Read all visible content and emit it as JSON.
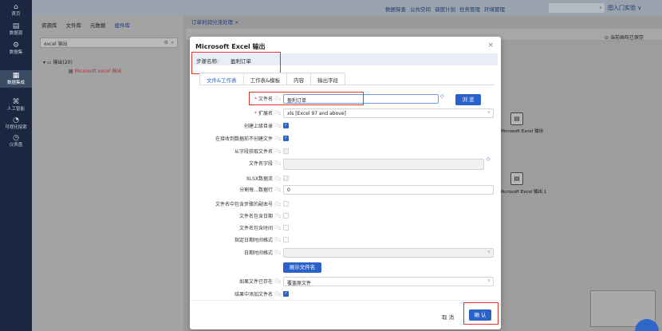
{
  "nav": [
    {
      "icon": "⌂",
      "label": "首页"
    },
    {
      "icon": "▤",
      "label": "数据源"
    },
    {
      "icon": "⚙",
      "label": "数据集"
    },
    {
      "icon": "▦",
      "label": "数据集成"
    },
    {
      "icon": "⌘",
      "label": "人工智能"
    },
    {
      "icon": "◔",
      "label": "可视化探索"
    },
    {
      "icon": "◷",
      "label": "仪表盘"
    }
  ],
  "topbar": {
    "menu": [
      "数据探查",
      "公共空间",
      "调度计划",
      "任务管理",
      "环境管理"
    ],
    "user": "图入门实验 ∨"
  },
  "panel": {
    "tabs": [
      "资源库",
      "文件库",
      "元数据",
      "组件库"
    ],
    "search_value": "excel 输出",
    "tree_group": "输出(20)",
    "tree_item": "Microsoft excel 输出"
  },
  "workspace": {
    "tab_title": "订单利润分流处理 ×",
    "saved_status": "当前画布已保存",
    "node1_label": "Microsoft Excel 输出",
    "node2_label": "Microsoft Excel 输出 1"
  },
  "dialog": {
    "title": "Microsoft Excel 输出",
    "step_label": "步骤名称:",
    "step_value": "盈利订单",
    "tabs": [
      "文件&工作表",
      "工作表&模板",
      "内容",
      "输出字段"
    ],
    "filename_label": "文件名",
    "filename_value": "盈利订单",
    "browse_label": "浏 览",
    "ext_label": "扩展名",
    "ext_value": "xls [Excel 97 and above]",
    "create_parent_label": "创建上级目录",
    "no_create_label": "在接收到数据前不创建文件",
    "from_field_label": "从字段获取文件名",
    "filename_field_label": "文件名字段",
    "xlsx_stream_label": "XLSX数据流",
    "split_label": "分割每...数据行",
    "split_value": "0",
    "copy_no_label": "文件名中包含步骤的副本号",
    "include_date_label": "文件名包含日期",
    "include_time_label": "文件名包含时间",
    "specify_fmt_label": "指定日期时间格式",
    "datetime_fmt_label": "日期时间格式",
    "show_filename_label": "展示文件名",
    "if_exists_label": "如果文件已存在",
    "if_exists_value": "覆盖原文件",
    "add_to_result_label": "结果中添加文件名",
    "cancel_label": "取 消",
    "ok_label": "确 认"
  }
}
